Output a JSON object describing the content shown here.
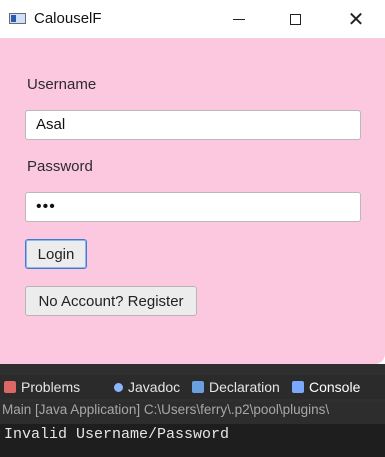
{
  "window": {
    "title": "CalouselF"
  },
  "form": {
    "username_label": "Username",
    "username_value": "Asal",
    "password_label": "Password",
    "password_mask": "•••",
    "login_label": "Login",
    "register_label": "No Account? Register"
  },
  "eclipse": {
    "tabs": [
      "Problems",
      "Javadoc",
      "Declaration",
      "Console"
    ],
    "path": "Main [Java Application] C:\\Users\\ferry\\.p2\\pool\\plugins\\",
    "console_output": "Invalid Username/Password"
  },
  "colors": {
    "form_background": "#fcc8e0",
    "console_background": "#1e1e1e",
    "login_border": "#3f7cd1"
  }
}
